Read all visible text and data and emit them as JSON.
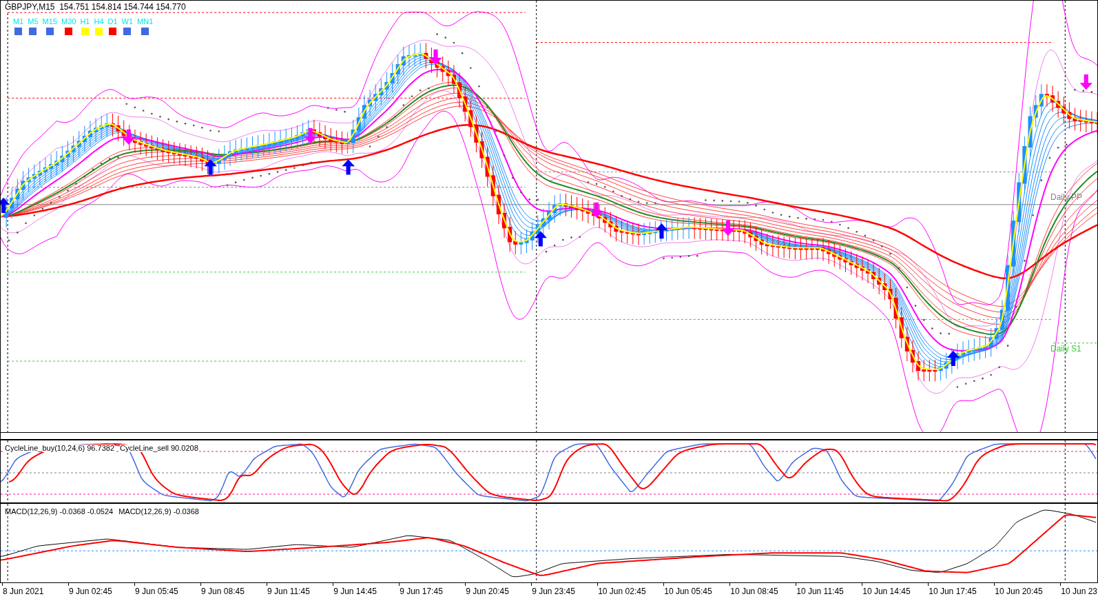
{
  "chart": {
    "symbol_line": "GBPJPY,M15  154.751 154.814 154.744 154.770",
    "timeframes": [
      {
        "label": "M1",
        "color": "#4169e1"
      },
      {
        "label": "M5",
        "color": "#4169e1"
      },
      {
        "label": "M15",
        "color": "#4169e1"
      },
      {
        "label": "M30",
        "color": "#ff0000"
      },
      {
        "label": "H1",
        "color": "#ffff00"
      },
      {
        "label": "H4",
        "color": "#ffff00"
      },
      {
        "label": "D1",
        "color": "#ff0000"
      },
      {
        "label": "W1",
        "color": "#4169e1"
      },
      {
        "label": "MN1",
        "color": "#4169e1"
      }
    ],
    "levels": [
      {
        "label": "Daily PP",
        "color": "#808080"
      },
      {
        "label": "Daily S1",
        "color": "#32cd32"
      }
    ]
  },
  "cycle_pane": {
    "labels": [
      "CycleLine_buy(10,24,6) 96.7382",
      "CycleLine_sell 90.0208"
    ]
  },
  "macd_pane": {
    "labels": [
      "MACD(12,26,9) -0.0368 -0.0524",
      "MACD(12,26,9) -0.0368"
    ]
  },
  "time_axis": [
    "8 Jun 2021",
    "9 Jun 02:45",
    "9 Jun 05:45",
    "9 Jun 08:45",
    "9 Jun 11:45",
    "9 Jun 14:45",
    "9 Jun 17:45",
    "9 Jun 20:45",
    "9 Jun 23:45",
    "10 Jun 02:45",
    "10 Jun 05:45",
    "10 Jun 08:45",
    "10 Jun 11:45",
    "10 Jun 14:45",
    "10 Jun 17:45",
    "10 Jun 20:45",
    "10 Jun 23"
  ]
}
